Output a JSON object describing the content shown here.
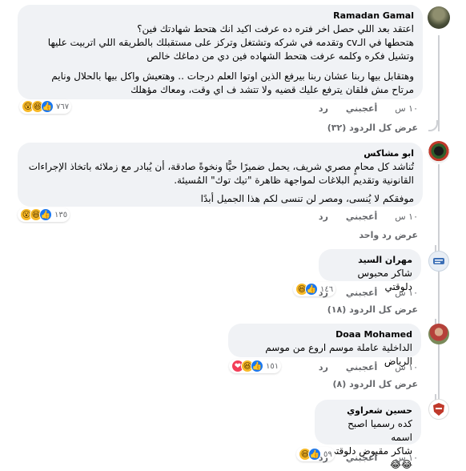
{
  "comments": [
    {
      "author": "Ramadan Gamal",
      "lines": [
        "اعتقد بعد اللي حصل اخر فتره ده عرفت اكيد انك هتحط شهادتك فين؟",
        "هتحطها في الـcv وتقدمه في شركه وتشتغل وتركز على مستقبلك بالطريقه اللي اتربيت عليها",
        "وتشيل فكره وكلمه عرفت هتحط الشهاده فين دي من دماغك خالص"
      ],
      "lines2": [
        "وهتقابل بيها ربنا عشان ربنا بيرفع الذين اوتوا العلم درجات .. وهتعيش واكل بيها بالحلال ونايم",
        "مرتاح مش فلقان يترفع عليك قضيه ولا تتشد ف اي وقت، ومعاك مؤهلك"
      ],
      "reaction_count": "٧٦٧",
      "time": "١٠ س",
      "like": "أعجبني",
      "reply": "رد",
      "view_replies": "عرض كل الردود (٣٢)"
    },
    {
      "author": "ابو مشاكس",
      "lines": [
        "تُناشد كل محامٍ مصري شريف، يحمل ضميرًا حيًّا ونخوةً صادقة، أن يُبادر مع زملائه باتخاذ الإجراءات",
        "القانونية وتقديم البلاغات لمواجهة ظاهرة \"تيك توك\" المُسيئة."
      ],
      "lines2": [
        "موفقكم لا يُنسى، ومصر لن تنسى لكم هذا الجميل أبدًا"
      ],
      "reaction_count": "١٣٥",
      "time": "١٠ س",
      "like": "أعجبني",
      "reply": "رد",
      "view_replies": "عرض رد واحد"
    },
    {
      "author": "مهران السيد",
      "lines": [
        "شاكر محبوس دلوقتي"
      ],
      "reaction_count": "١٤٦",
      "time": "١٠ س",
      "like": "أعجبني",
      "reply": "رد",
      "view_replies": "عرض كل الردود (١٨)"
    },
    {
      "author": "Doaa Mohamed",
      "lines": [
        "الداخلية عاملة موسم اروع من موسم الرياض"
      ],
      "reaction_count": "١٥١",
      "time": "١٠ س",
      "like": "أعجبني",
      "reply": "رد",
      "view_replies": "عرض كل الردود (٨)"
    },
    {
      "author": "حسين شعراوي",
      "lines": [
        "كده رسميا اصبح اسمه",
        "شاكر مقبوض دلوقتي 😂😂"
      ],
      "reaction_count": "٥٩",
      "time": "١٠ س",
      "like": "أعجبني",
      "reply": "رد"
    }
  ]
}
